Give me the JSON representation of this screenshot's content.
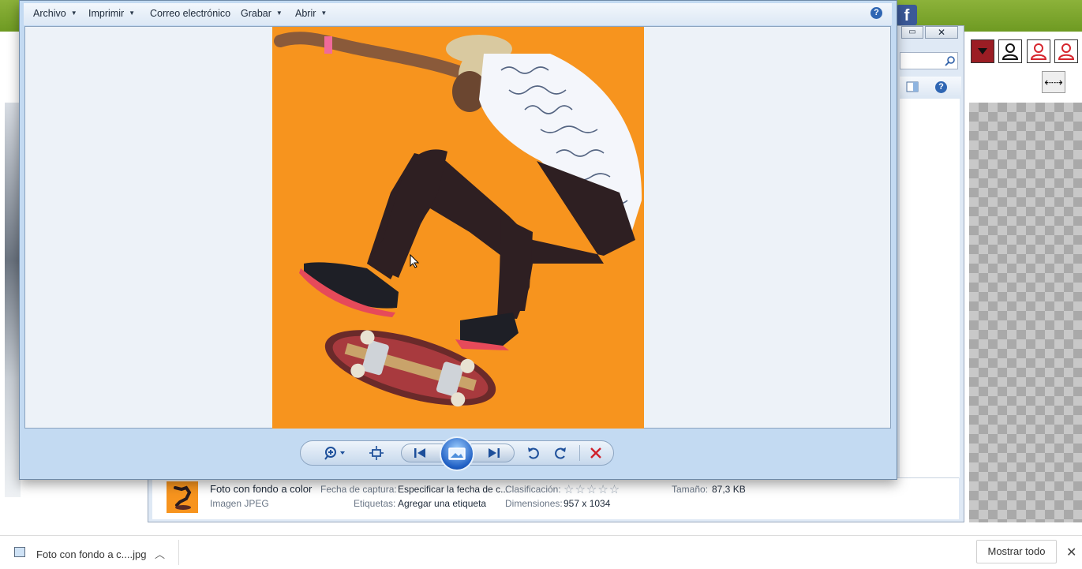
{
  "viewer": {
    "menu": [
      {
        "label": "Archivo"
      },
      {
        "label": "Imprimir"
      },
      {
        "label": "Correo electrónico"
      },
      {
        "label": "Grabar"
      },
      {
        "label": "Abrir"
      }
    ],
    "help_glyph": "?",
    "controls": {
      "zoom_icon": "magnifier-zoom-icon",
      "fit_icon": "actual-size-icon",
      "previous_icon": "previous-icon",
      "slideshow_icon": "slideshow-icon",
      "next_icon": "next-icon",
      "rotate_left_icon": "rotate-counterclockwise-icon",
      "rotate_right_icon": "rotate-clockwise-icon",
      "delete_icon": "delete-icon"
    },
    "photo_background": "#f7941e"
  },
  "explorer": {
    "details": {
      "name": "Foto con fondo a color",
      "type": "Imagen JPEG",
      "capture_label": "Fecha de captura:",
      "capture_value": "Especificar la fecha de c...",
      "tags_label": "Etiquetas:",
      "tags_value": "Agregar una etiqueta",
      "rating_label": "Clasificación:",
      "rating_stars": "☆☆☆☆☆",
      "rating_value": 0,
      "dimensions_label": "Dimensiones:",
      "dimensions_value": "957 x 1034",
      "size_label": "Tamaño:",
      "size_value": "87,3 KB"
    },
    "window_buttons": {
      "maximize": "▭",
      "close": "✕"
    }
  },
  "background": {
    "facebook_glyph": "f",
    "swap_glyph": "⇠⇢"
  },
  "download_bar": {
    "filename": "Foto con fondo a c....jpg",
    "chevron": "︿",
    "show_all": "Mostrar todo",
    "close": "✕"
  },
  "colors": {
    "accent_green": "#7aa52c",
    "viewer_frame": "#c3daf2",
    "delete_red": "#d0202a",
    "user_red": "#d6252d"
  }
}
